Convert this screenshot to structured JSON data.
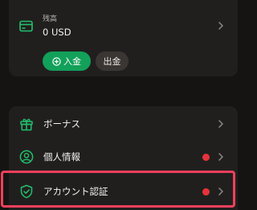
{
  "balance": {
    "label": "残高",
    "value": "0 USD",
    "deposit_label": "入金",
    "withdraw_label": "出金"
  },
  "menu": {
    "items": [
      {
        "label": "ボーナス",
        "icon": "gift-icon",
        "badge": false
      },
      {
        "label": "個人情報",
        "icon": "user-circle-icon",
        "badge": true
      },
      {
        "label": "アカウント認証",
        "icon": "shield-check-icon",
        "badge": true
      }
    ]
  },
  "colors": {
    "background": "#151413",
    "card": "#211f1e",
    "accent_green": "#12a05a",
    "badge_red": "#e5333b",
    "highlight": "#f0405c"
  }
}
